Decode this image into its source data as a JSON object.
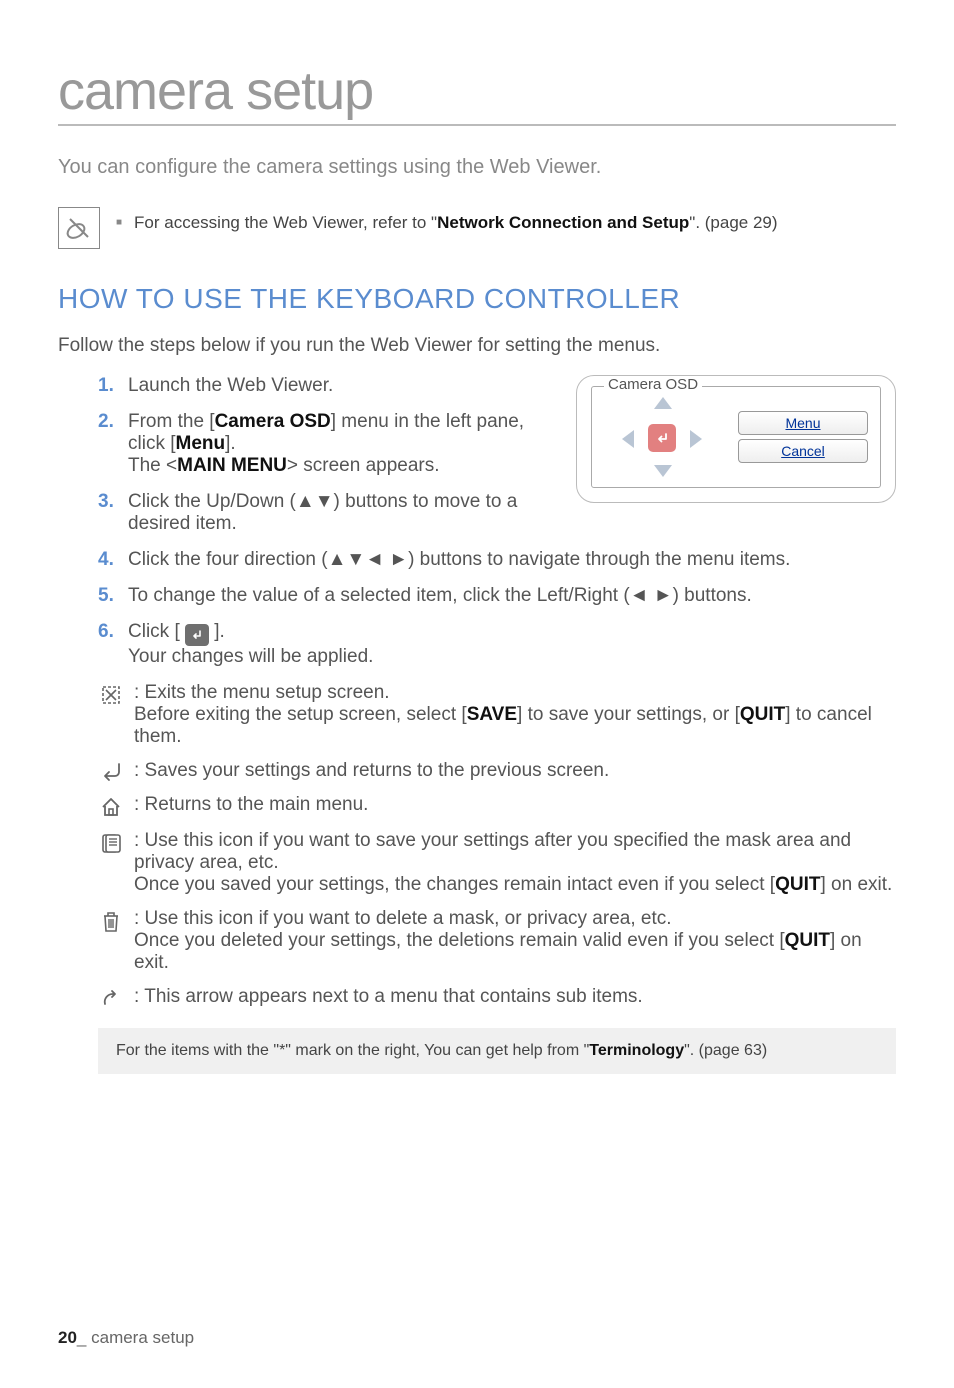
{
  "chapter_title": "camera setup",
  "intro": "You can configure the camera settings using the Web Viewer.",
  "note": {
    "prefix": "For accessing the Web Viewer, refer to \"",
    "bold": "Network Connection and Setup",
    "suffix": "\". (page 29)"
  },
  "section_title": "HOW TO USE THE KEYBOARD CONTROLLER",
  "section_intro": "Follow the steps below if you run the Web Viewer for setting the menus.",
  "steps": [
    {
      "num": "1.",
      "html": "Launch the Web Viewer."
    },
    {
      "num": "2.",
      "html": "From the [<b>Camera OSD</b>] menu in the left pane, click [<b>Menu</b>].<br>The &lt;<b>MAIN MENU</b>&gt; screen appears."
    },
    {
      "num": "3.",
      "html": "Click the Up/Down (<span class='arrow-glyph'>▲▼</span>) buttons to move to a desired item."
    },
    {
      "num": "4.",
      "html": "Click the four direction (<span class='arrow-glyph'>▲▼◄ ►</span>) buttons to navigate through the menu items."
    },
    {
      "num": "5.",
      "html": "To change the value of a selected item, click the Left/Right (<span class='arrow-glyph'>◄ ►</span>) buttons."
    },
    {
      "num": "6.",
      "html": "Click [ <span class='enter-badge'><svg width='14' height='14' viewBox='0 0 14 14'><path d='M10 3 V8 H4 M4 8 L6 6 M4 8 L6 10' stroke='#fff' stroke-width='1.6' fill='none' stroke-linecap='round' stroke-linejoin='round'/></svg></span> ].<br>Your changes will be applied."
    }
  ],
  "osd_box": {
    "legend": "Camera OSD",
    "menu_btn": "Menu",
    "cancel_btn": "Cancel"
  },
  "icons": [
    {
      "icon": "exit",
      "html": ": Exits the menu setup screen.<br>Before exiting the setup screen, select [<b>SAVE</b>] to save your settings, or [<b>QUIT</b>] to cancel them."
    },
    {
      "icon": "back",
      "html": ": Saves your settings and returns to the previous screen."
    },
    {
      "icon": "home",
      "html": ": Returns to the main menu."
    },
    {
      "icon": "save",
      "html": ": Use this icon if you want to save your settings after you specified the mask area and privacy area, etc.<br>Once you saved your settings, the changes remain intact even if you select [<b>QUIT</b>] on exit."
    },
    {
      "icon": "delete",
      "html": ": Use this icon if you want to delete a mask, or privacy area, etc.<br>Once you deleted your settings, the deletions remain valid even if you select [<b>QUIT</b>] on exit."
    },
    {
      "icon": "sub",
      "html": ": This arrow appears next to a menu that contains sub items."
    }
  ],
  "ref": {
    "prefix": "For the items with the \"*\" mark on the right, You can get help from \"",
    "bold": "Terminology",
    "suffix": "\". (page 63)"
  },
  "footer": {
    "page": "20",
    "sep": "_ ",
    "label": "camera setup"
  }
}
